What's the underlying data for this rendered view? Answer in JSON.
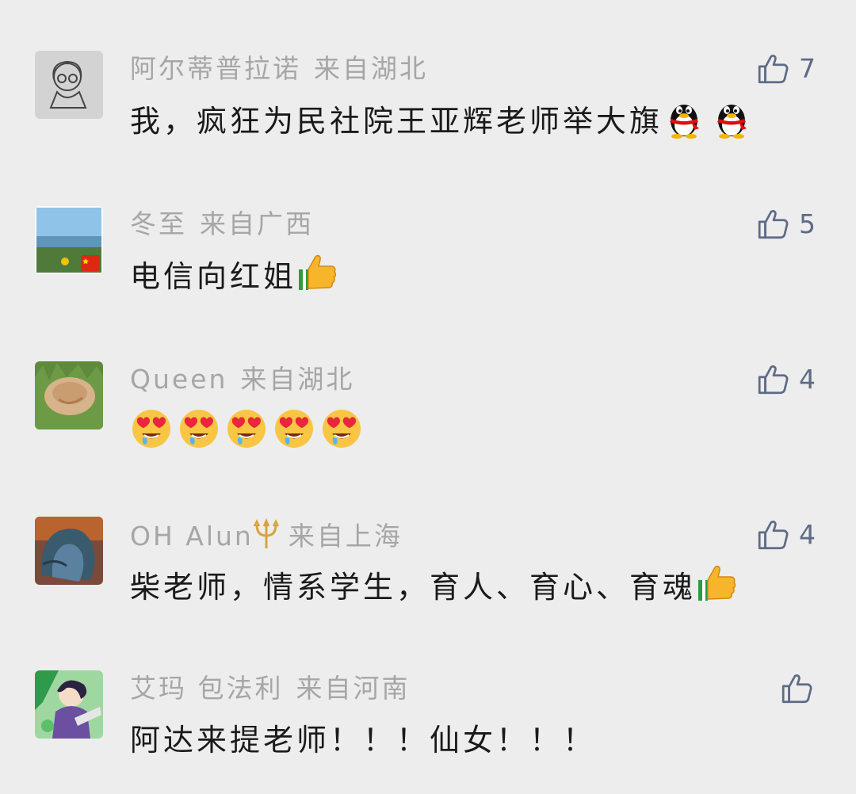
{
  "comments": [
    {
      "name": "阿尔蒂普拉诺",
      "location": "来自湖北",
      "text": "我，疯狂为民社院王亚辉老师举大旗",
      "text_emojis": [
        "qq-penguin-icon",
        "qq-penguin-icon"
      ],
      "likes": "7"
    },
    {
      "name": "冬至",
      "location": "来自广西",
      "text": "电信向红姐",
      "text_emojis": [
        "thumbs-up-icon"
      ],
      "likes": "5"
    },
    {
      "name": "Queen",
      "location": "来自湖北",
      "text": "",
      "text_emojis": [
        "heart-eyes-drool-icon",
        "heart-eyes-drool-icon",
        "heart-eyes-drool-icon",
        "heart-eyes-drool-icon",
        "heart-eyes-drool-icon"
      ],
      "likes": "4"
    },
    {
      "name": "OH Alun",
      "name_emoji": "trident-icon",
      "location": "来自上海",
      "text": "柴老师，情系学生，育人、育心、育魂",
      "text_emojis": [
        "thumbs-up-icon"
      ],
      "likes": "4"
    },
    {
      "name": "艾玛 包法利",
      "location": "来自河南",
      "text": "阿达来提老师！！！仙女！！！",
      "text_emojis": [],
      "likes": ""
    }
  ],
  "colors": {
    "background": "#ededed",
    "meta_text": "#a6a6a6",
    "comment_text": "#1a1a1a",
    "like_icon": "#5e6b86"
  }
}
